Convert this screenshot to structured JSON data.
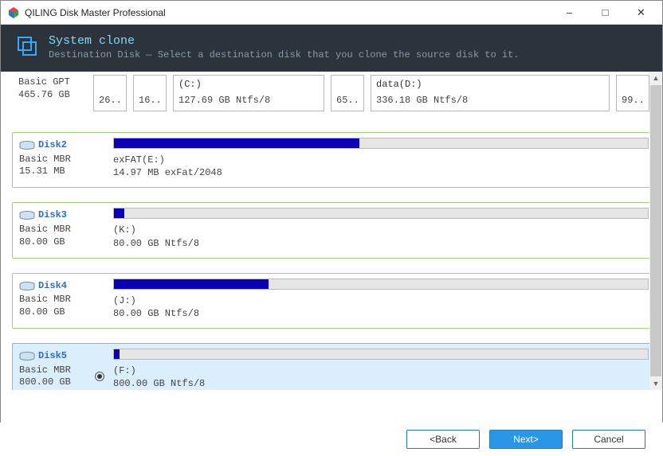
{
  "window": {
    "title": "QILING Disk Master Professional"
  },
  "header": {
    "title": "System clone",
    "subtitle": "Destination Disk — Select a destination disk that you clone the source disk to it."
  },
  "disk0": {
    "type": "Basic GPT",
    "size": "465.76 GB",
    "stubs": {
      "s0": "26...",
      "s1": "16...",
      "s2_lbl": "(C:)",
      "s2_meta": "127.69 GB Ntfs/8",
      "s3": "65...",
      "s4_lbl": "data(D:)",
      "s4_meta": "336.18 GB Ntfs/8",
      "s5": "99..."
    }
  },
  "disk2": {
    "name": "Disk2",
    "type": "Basic MBR",
    "size": "15.31 MB",
    "part_label": "exFAT(E:)",
    "part_meta": "14.97 MB exFat/2048"
  },
  "disk3": {
    "name": "Disk3",
    "type": "Basic MBR",
    "size": "80.00 GB",
    "part_label": "(K:)",
    "part_meta": "80.00 GB Ntfs/8"
  },
  "disk4": {
    "name": "Disk4",
    "type": "Basic MBR",
    "size": "80.00 GB",
    "part_label": "(J:)",
    "part_meta": "80.00 GB Ntfs/8"
  },
  "disk5": {
    "name": "Disk5",
    "type": "Basic MBR",
    "size": "800.00 GB",
    "part_label": "(F:)",
    "part_meta": "800.00 GB Ntfs/8"
  },
  "footer": {
    "back": "<Back",
    "next": "Next>",
    "cancel": "Cancel"
  }
}
